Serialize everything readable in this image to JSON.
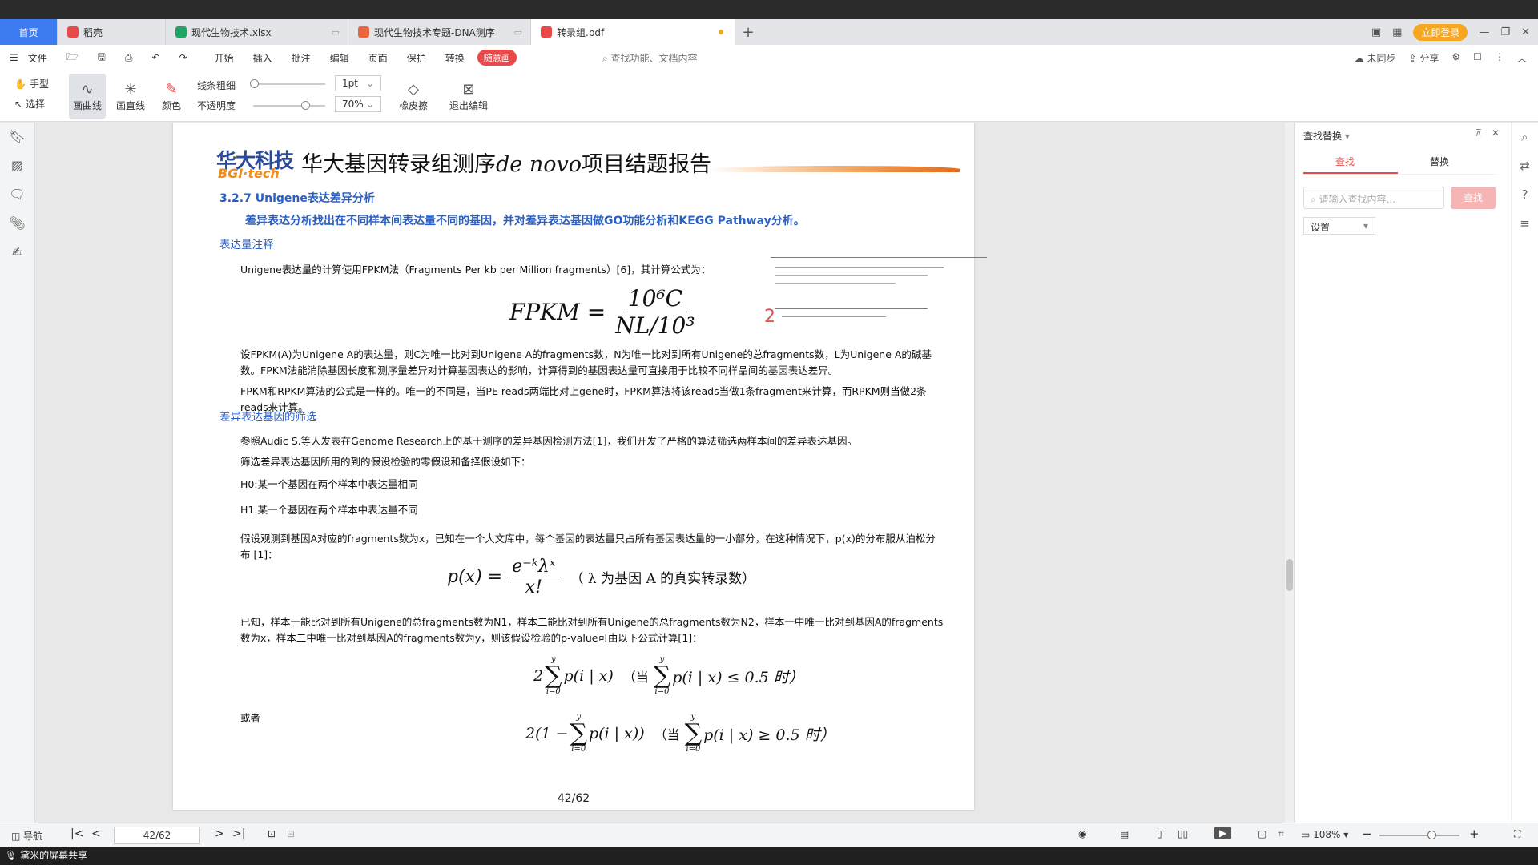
{
  "tabs": [
    {
      "label": "首页"
    },
    {
      "label": "稻壳"
    },
    {
      "label": "现代生物技术.xlsx"
    },
    {
      "label": "现代生物技术专题-DNA测序"
    },
    {
      "label": "转录组.pdf"
    }
  ],
  "window": {
    "login_label": "立即登录"
  },
  "menu": {
    "file": "文件",
    "items": [
      "开始",
      "插入",
      "批注",
      "编辑",
      "页面",
      "保护",
      "转换"
    ],
    "pill": "随意画",
    "search": "查找功能、文档内容",
    "sync": "未同步",
    "share": "分享"
  },
  "toolbar": {
    "hand": "手型",
    "select": "选择",
    "draw_curve": "画曲线",
    "draw_line": "画直线",
    "color": "颜色",
    "line_width": "线条粗细",
    "opacity": "不透明度",
    "width_value": "1pt",
    "opacity_value": "70%",
    "eraser": "橡皮擦",
    "exit_edit": "退出编辑"
  },
  "document": {
    "logo_cn": "华大科技",
    "logo_en": "BGI·tech",
    "header_title_a": "华大基因转录组测序",
    "header_title_em": "de novo",
    "header_title_b": "项目结题报告",
    "section": "3.2.7 Unigene表达差异分析",
    "intro": "差异表达分析找出在不同样本间表达量不同的基因，并对差异表达基因做GO功能分析和KEGG Pathway分析。",
    "sub1": "表达量注释",
    "p1": "Unigene表达量的计算使用FPKM法（Fragments Per kb per Million fragments）[6]，其计算公式为：",
    "f1_lhs": "FPKM =",
    "f1_num": "10⁶C",
    "f1_den": "NL/10³",
    "p2": "设FPKM(A)为Unigene A的表达量，则C为唯一比对到Unigene A的fragments数，N为唯一比对到所有Unigene的总fragments数，L为Unigene A的碱基数。FPKM法能消除基因长度和测序量差异对计算基因表达的影响，计算得到的基因表达量可直接用于比较不同样品间的基因表达差异。",
    "p3": "FPKM和RPKM算法的公式是一样的。唯一的不同是，当PE reads两端比对上gene时，FPKM算法将该reads当做1条fragment来计算，而RPKM则当做2条reads来计算。",
    "sub2": "差异表达基因的筛选",
    "p4": "参照Audic S.等人发表在Genome Research上的基于测序的差异基因检测方法[1]，我们开发了严格的算法筛选两样本间的差异表达基因。",
    "p5": "筛选差异表达基因所用的到的假设检验的零假设和备择假设如下：",
    "h0": "H0:某一个基因在两个样本中表达量相同",
    "h1": "H1:某一个基因在两个样本中表达量不同",
    "p6": "假设观测到基因A对应的fragments数为x，已知在一个大文库中，每个基因的表达量只占所有基因表达量的一小部分，在这种情况下，p(x)的分布服从泊松分布 [1]：",
    "f2_lhs": "p(x) =",
    "f2_num": "e⁻ᵏλˣ",
    "f2_den": "x!",
    "f2_note": "（ λ 为基因 A 的真实转录数）",
    "p7": "已知，样本一能比对到所有Unigene的总fragments数为N1，样本二能比对到所有Unigene的总fragments数为N2，样本一中唯一比对到基因A的fragments数为x，样本二中唯一比对到基因A的fragments数为y，则该假设检验的p-value可由以下公式计算[1]：",
    "f3_a": "2",
    "f3_b": "p(i | x)",
    "f3_c": "（当",
    "f3_d": "p(i | x) ≤ 0.5 时）",
    "or": "或者",
    "f4_a": "2(1 −",
    "f4_b": "p(i | x))",
    "f4_c": "（当",
    "f4_d": "p(i | x) ≥ 0.5 时）",
    "sig_top": "y",
    "sig_bot": "i=0",
    "page_label": "42/62"
  },
  "find_panel": {
    "title": "查找替换",
    "tab_find": "查找",
    "tab_replace": "替换",
    "placeholder": "请输入查找内容...",
    "find_btn": "查找",
    "settings": "设置"
  },
  "status": {
    "nav": "导航",
    "page_input": "42/62",
    "zoom": "108%"
  },
  "taskbar": {
    "label": "黛米的屏幕共享"
  }
}
